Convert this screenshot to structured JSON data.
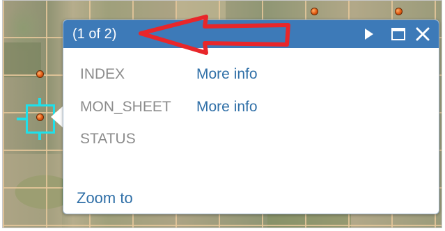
{
  "colors": {
    "header_bg": "#3d7ab8",
    "link": "#2f6fa7",
    "label": "#8c8c8c",
    "selection": "#1fe0ea",
    "marker": "#e05a12",
    "annotation_arrow": "#e8262a"
  },
  "popup": {
    "title": "(1 of 2)",
    "header_icons": [
      "play-next-icon",
      "maximize-icon",
      "close-icon"
    ],
    "rows": [
      {
        "label": "INDEX",
        "value": "More info"
      },
      {
        "label": "MON_SHEET",
        "value": "More info"
      },
      {
        "label": "STATUS",
        "value": ""
      }
    ],
    "zoom_label": "Zoom to"
  }
}
